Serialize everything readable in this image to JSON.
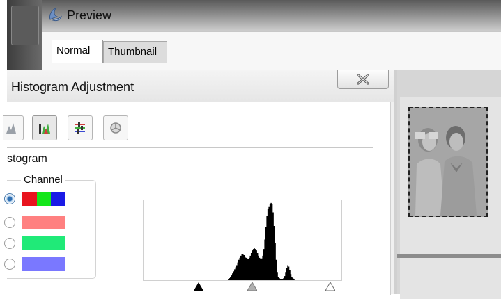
{
  "window": {
    "title": "Preview",
    "icon": "app-logo-icon"
  },
  "tabs": [
    {
      "label": "Normal",
      "selected": true
    },
    {
      "label": "Thumbnail",
      "selected": false
    }
  ],
  "dialog": {
    "title": "Histogram Adjustment",
    "close_icon": "close-icon",
    "toolbar": [
      {
        "icon": "histogram-tool-icon",
        "active": false
      },
      {
        "icon": "levels-tool-icon",
        "active": true
      },
      {
        "icon": "color-balance-icon",
        "active": false
      },
      {
        "icon": "reset-icon",
        "active": false
      }
    ],
    "section_label": "stogram",
    "channel": {
      "legend": "Channel",
      "options": [
        {
          "name": "rgb",
          "colors": [
            "#e8141e",
            "#14e61a",
            "#1a1ae6"
          ],
          "checked": true
        },
        {
          "name": "red",
          "colors": [
            "#ff8080"
          ],
          "checked": false
        },
        {
          "name": "green",
          "colors": [
            "#20ea78"
          ],
          "checked": false
        },
        {
          "name": "blue",
          "colors": [
            "#7a78ff"
          ],
          "checked": false
        }
      ]
    },
    "histogram": {
      "bins": [
        0,
        0,
        0,
        0,
        0,
        0,
        0,
        0,
        0,
        0,
        0,
        0,
        0,
        0,
        0,
        0,
        0,
        0,
        0,
        0,
        0,
        0,
        0,
        0,
        0,
        0,
        0,
        0,
        0,
        0,
        0,
        0,
        0,
        0,
        0,
        0,
        0,
        0,
        0,
        0,
        0,
        0,
        0,
        0,
        0,
        0,
        0,
        0,
        0,
        0,
        0,
        0,
        0,
        0,
        0,
        0,
        0,
        0,
        0,
        0,
        0,
        0,
        0,
        0,
        0,
        0,
        0,
        0,
        0,
        0,
        0,
        0,
        0,
        0,
        0,
        0,
        0,
        0,
        0,
        0,
        1,
        2,
        3,
        5,
        7,
        10,
        13,
        16,
        19,
        22,
        26,
        30,
        33,
        36,
        38,
        38,
        37,
        35,
        33,
        32,
        31,
        33,
        36,
        40,
        44,
        46,
        47,
        46,
        44,
        40,
        36,
        33,
        31,
        32,
        36,
        46,
        60,
        78,
        95,
        105,
        109,
        112,
        114,
        112,
        100,
        80,
        55,
        30,
        12,
        5,
        3,
        2,
        2,
        2,
        3,
        6,
        12,
        18,
        22,
        20,
        15,
        9,
        5,
        3,
        2,
        1,
        1,
        1,
        1,
        1,
        0,
        0,
        0,
        0,
        0,
        0,
        0,
        0,
        0,
        0,
        0,
        0,
        0,
        0,
        0,
        0,
        0,
        0,
        0,
        0,
        0,
        0,
        0,
        0,
        0,
        0,
        0,
        0,
        0,
        0,
        0,
        0,
        0,
        0,
        0,
        0,
        0,
        0,
        0,
        0
      ],
      "max": 118,
      "black_point": 0.28,
      "gamma_point": 0.55,
      "white_point": 0.94
    }
  },
  "colors": {
    "tab_active": "#ffffff",
    "dialog_bg": "#f0f0f0"
  }
}
